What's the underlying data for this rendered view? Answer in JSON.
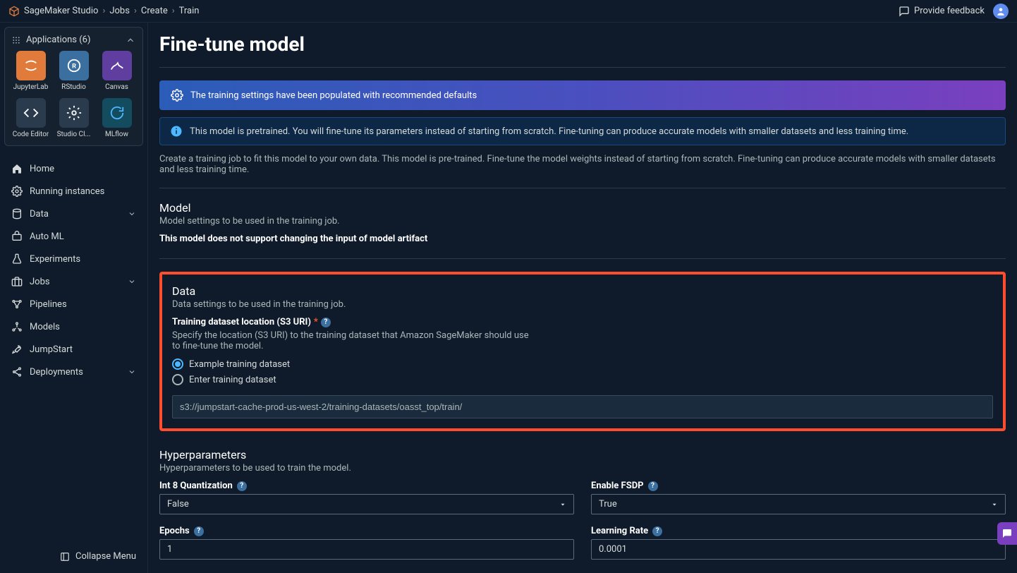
{
  "breadcrumb": [
    "SageMaker Studio",
    "Jobs",
    "Create",
    "Train"
  ],
  "top": {
    "feedback": "Provide feedback"
  },
  "sidebar": {
    "apps_header": "Applications (6)",
    "apps": [
      {
        "label": "JupyterLab",
        "tile": "orange"
      },
      {
        "label": "RStudio",
        "tile": "blue"
      },
      {
        "label": "Canvas",
        "tile": "purple"
      },
      {
        "label": "Code Editor",
        "tile": "dark"
      },
      {
        "label": "Studio Cl...",
        "tile": "dark"
      },
      {
        "label": "MLflow",
        "tile": "teal"
      }
    ],
    "nav": [
      {
        "label": "Home",
        "chev": false
      },
      {
        "label": "Running instances",
        "chev": false
      },
      {
        "label": "Data",
        "chev": true
      },
      {
        "label": "Auto ML",
        "chev": false
      },
      {
        "label": "Experiments",
        "chev": false
      },
      {
        "label": "Jobs",
        "chev": true
      },
      {
        "label": "Pipelines",
        "chev": false
      },
      {
        "label": "Models",
        "chev": false
      },
      {
        "label": "JumpStart",
        "chev": false
      },
      {
        "label": "Deployments",
        "chev": true
      }
    ],
    "collapse": "Collapse Menu"
  },
  "page": {
    "title": "Fine-tune model",
    "banner1": "The training settings have been populated with recommended defaults",
    "banner2": "This model is pretrained. You will fine-tune its parameters instead of starting from scratch. Fine-tuning can produce accurate models with smaller datasets and less training time.",
    "desc": "Create a training job to fit this model to your own data. This model is pre-trained. Fine-tune the model weights instead of starting from scratch. Fine-tuning can produce accurate models with smaller datasets and less training time."
  },
  "model": {
    "title": "Model",
    "sub": "Model settings to be used in the training job.",
    "note": "This model does not support changing the input of model artifact"
  },
  "data_section": {
    "title": "Data",
    "sub": "Data settings to be used in the training job.",
    "field_label": "Training dataset location (S3 URI)",
    "field_desc": "Specify the location (S3 URI) to the training dataset that Amazon SageMaker should use to fine-tune the model.",
    "radio1": "Example training dataset",
    "radio2": "Enter training dataset",
    "s3_value": "s3://jumpstart-cache-prod-us-west-2/training-datasets/oasst_top/train/"
  },
  "hyper": {
    "title": "Hyperparameters",
    "sub": "Hyperparameters to be used to train the model.",
    "int8": {
      "label": "Int 8 Quantization",
      "value": "False"
    },
    "fsdp": {
      "label": "Enable FSDP",
      "value": "True"
    },
    "epochs": {
      "label": "Epochs",
      "value": "1"
    },
    "lr": {
      "label": "Learning Rate",
      "value": "0.0001"
    }
  }
}
